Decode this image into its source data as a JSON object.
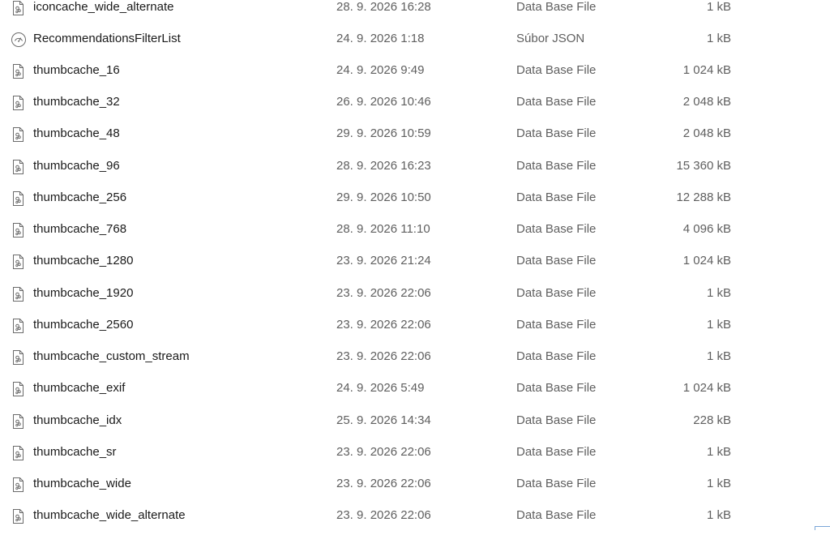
{
  "files": [
    {
      "name": "iconcache_wide_alternate",
      "modified": "28. 9. 2026 16:28",
      "type": "Data Base File",
      "size": "1 kB",
      "icon": "database-file-icon"
    },
    {
      "name": "RecommendationsFilterList",
      "modified": "24. 9. 2026 1:18",
      "type": "Súbor JSON",
      "size": "1 kB",
      "icon": "json-file-icon"
    },
    {
      "name": "thumbcache_16",
      "modified": "24. 9. 2026 9:49",
      "type": "Data Base File",
      "size": "1 024 kB",
      "icon": "database-file-icon"
    },
    {
      "name": "thumbcache_32",
      "modified": "26. 9. 2026 10:46",
      "type": "Data Base File",
      "size": "2 048 kB",
      "icon": "database-file-icon"
    },
    {
      "name": "thumbcache_48",
      "modified": "29. 9. 2026 10:59",
      "type": "Data Base File",
      "size": "2 048 kB",
      "icon": "database-file-icon"
    },
    {
      "name": "thumbcache_96",
      "modified": "28. 9. 2026 16:23",
      "type": "Data Base File",
      "size": "15 360 kB",
      "icon": "database-file-icon"
    },
    {
      "name": "thumbcache_256",
      "modified": "29. 9. 2026 10:50",
      "type": "Data Base File",
      "size": "12 288 kB",
      "icon": "database-file-icon"
    },
    {
      "name": "thumbcache_768",
      "modified": "28. 9. 2026 11:10",
      "type": "Data Base File",
      "size": "4 096 kB",
      "icon": "database-file-icon"
    },
    {
      "name": "thumbcache_1280",
      "modified": "23. 9. 2026 21:24",
      "type": "Data Base File",
      "size": "1 024 kB",
      "icon": "database-file-icon"
    },
    {
      "name": "thumbcache_1920",
      "modified": "23. 9. 2026 22:06",
      "type": "Data Base File",
      "size": "1 kB",
      "icon": "database-file-icon"
    },
    {
      "name": "thumbcache_2560",
      "modified": "23. 9. 2026 22:06",
      "type": "Data Base File",
      "size": "1 kB",
      "icon": "database-file-icon"
    },
    {
      "name": "thumbcache_custom_stream",
      "modified": "23. 9. 2026 22:06",
      "type": "Data Base File",
      "size": "1 kB",
      "icon": "database-file-icon"
    },
    {
      "name": "thumbcache_exif",
      "modified": "24. 9. 2026 5:49",
      "type": "Data Base File",
      "size": "1 024 kB",
      "icon": "database-file-icon"
    },
    {
      "name": "thumbcache_idx",
      "modified": "25. 9. 2026 14:34",
      "type": "Data Base File",
      "size": "228 kB",
      "icon": "database-file-icon"
    },
    {
      "name": "thumbcache_sr",
      "modified": "23. 9. 2026 22:06",
      "type": "Data Base File",
      "size": "1 kB",
      "icon": "database-file-icon"
    },
    {
      "name": "thumbcache_wide",
      "modified": "23. 9. 2026 22:06",
      "type": "Data Base File",
      "size": "1 kB",
      "icon": "database-file-icon"
    },
    {
      "name": "thumbcache_wide_alternate",
      "modified": "23. 9. 2026 22:06",
      "type": "Data Base File",
      "size": "1 kB",
      "icon": "database-file-icon"
    }
  ],
  "colors": {
    "name_text": "#1a1a1a",
    "detail_text": "#5f5f5f",
    "background": "#ffffff"
  }
}
